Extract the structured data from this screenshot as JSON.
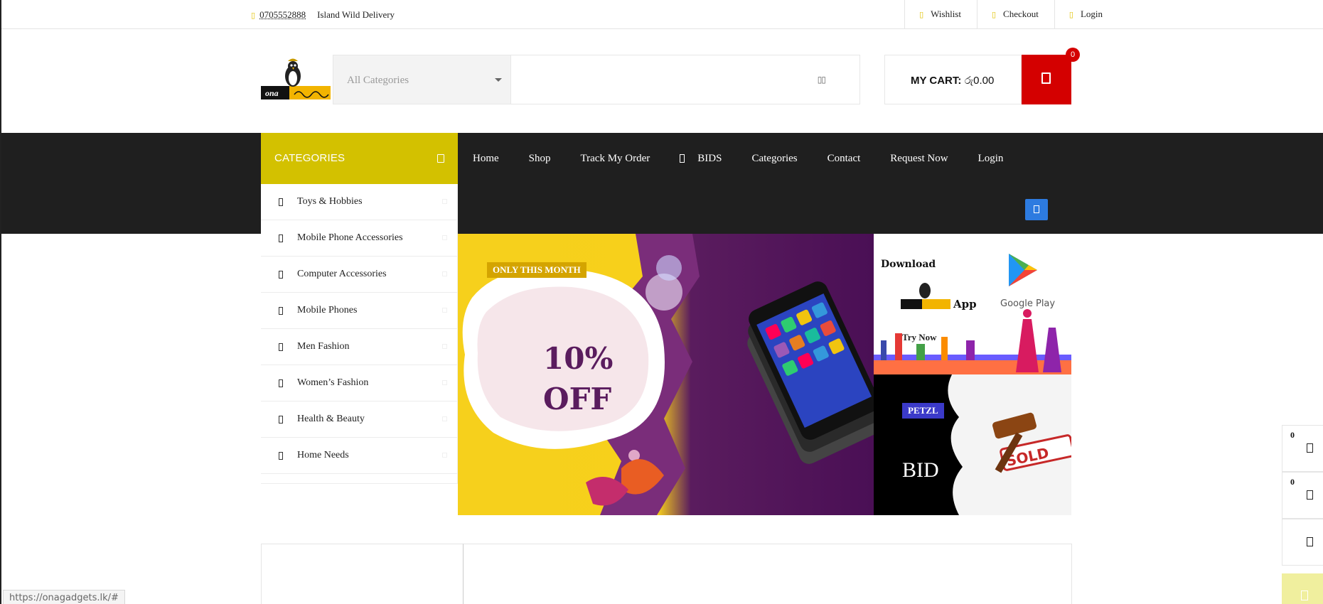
{
  "topbar": {
    "phone": "0705552888",
    "delivery": "Island Wild Delivery",
    "links": [
      {
        "label": "Wishlist",
        "icon": "heart-icon"
      },
      {
        "label": "Checkout",
        "icon": "check-icon"
      },
      {
        "label": "Login",
        "icon": "user-icon"
      }
    ]
  },
  "header": {
    "category_select": "All Categories",
    "search_placeholder": "",
    "cart_label": "MY CART:",
    "cart_amount": "රු0.00",
    "cart_count": "0"
  },
  "nav": {
    "categories_title": "CATEGORIES",
    "items": [
      "Home",
      "Shop",
      "Track My Order",
      "BIDS",
      "Categories",
      "Contact",
      "Request Now",
      "Login"
    ]
  },
  "categories": [
    "Toys & Hobbies",
    "Mobile Phone Accessories",
    "Computer Accessories",
    "Mobile Phones",
    "Men Fashion",
    "Women’s Fashion",
    "Health & Beauty",
    "Home Needs"
  ],
  "hero": {
    "tag": "ONLY THIS MONTH",
    "discount_line1": "10%",
    "discount_line2": "OFF"
  },
  "side_banners": {
    "download_text": "Download",
    "app_text": "App",
    "store_text": "Google Play",
    "try_now": "Try Now",
    "bid_tag": "PETZL",
    "bid_text": "BID",
    "sold_text": "SOLD"
  },
  "logo_text": "ona",
  "floating": {
    "wishlist_count": "0",
    "compare_count": "0"
  },
  "status_url": "https://onagadgets.lk/#",
  "colors": {
    "accent": "#d3c100",
    "cart_red": "#d40000",
    "nav_dark": "#1f1f1f",
    "blue": "#2d7be0"
  }
}
